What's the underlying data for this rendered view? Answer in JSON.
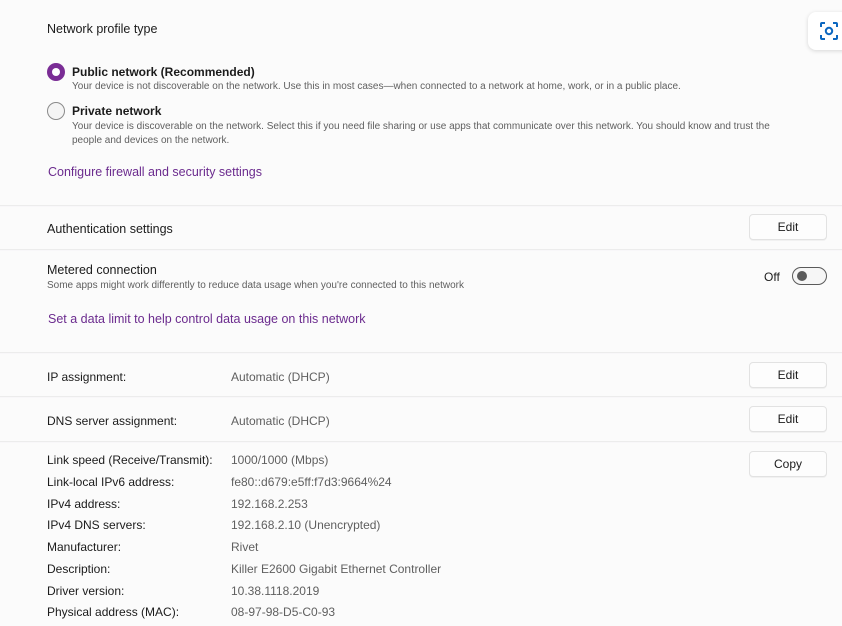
{
  "network_profile": {
    "title": "Network profile type",
    "options": [
      {
        "label": "Public network (Recommended)",
        "description": "Your device is not discoverable on the network. Use this in most cases—when connected to a network at home, work, or in a public place.",
        "selected": true
      },
      {
        "label": "Private network",
        "description_line1": "Your device is discoverable on the network. Select this if you need file sharing or use apps that communicate over this network. You should know and trust the",
        "description_line2": "people and devices on the network.",
        "selected": false
      }
    ],
    "firewall_link": "Configure firewall and security settings"
  },
  "authentication": {
    "label": "Authentication settings",
    "button": "Edit"
  },
  "metered": {
    "label": "Metered connection",
    "description": "Some apps might work differently to reduce data usage when you're connected to this network",
    "toggle_state": "Off",
    "data_limit_link": "Set a data limit to help control data usage on this network"
  },
  "ip_assignment": {
    "label": "IP assignment:",
    "value": "Automatic (DHCP)",
    "button": "Edit"
  },
  "dns_assignment": {
    "label": "DNS server assignment:",
    "value": "Automatic (DHCP)",
    "button": "Edit"
  },
  "properties": {
    "copy_button": "Copy",
    "rows": [
      {
        "label": "Link speed (Receive/Transmit):",
        "value": "1000/1000 (Mbps)"
      },
      {
        "label": "Link-local IPv6 address:",
        "value": "fe80::d679:e5ff:f7d3:9664%24"
      },
      {
        "label": "IPv4 address:",
        "value": "192.168.2.253"
      },
      {
        "label": "IPv4 DNS servers:",
        "value": "192.168.2.10 (Unencrypted)"
      },
      {
        "label": "Manufacturer:",
        "value": "Rivet"
      },
      {
        "label": "Description:",
        "value": "Killer E2600 Gigabit Ethernet Controller"
      },
      {
        "label": "Driver version:",
        "value": "10.38.1118.2019"
      },
      {
        "label": "Physical address (MAC):",
        "value": "08-97-98-D5-C0-93"
      }
    ]
  },
  "colors": {
    "accent": "#7a2c95",
    "link": "#6b2b8e"
  }
}
